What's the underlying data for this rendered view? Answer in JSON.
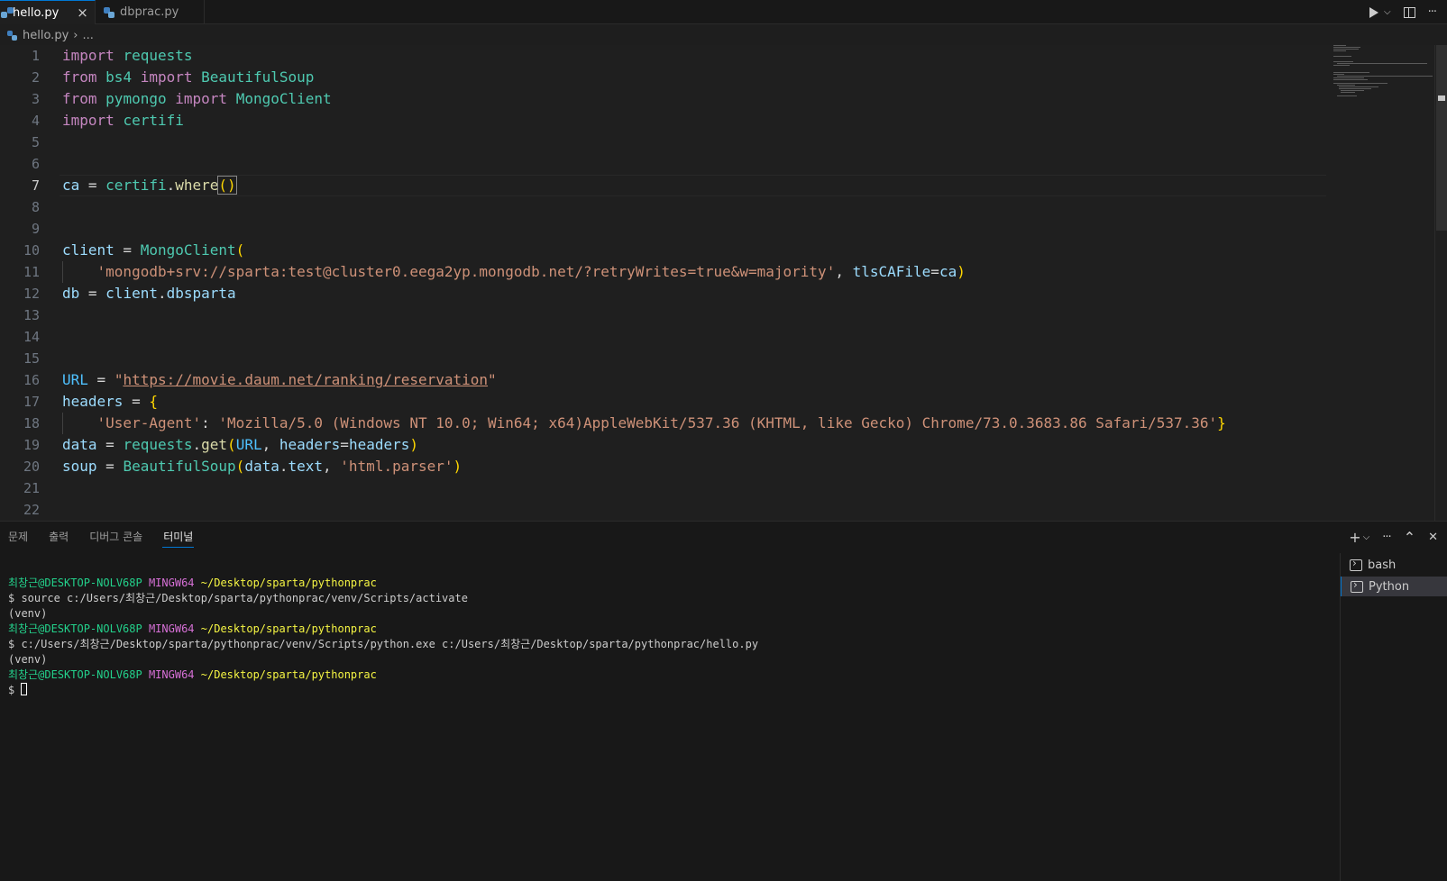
{
  "tabs": [
    {
      "label": "hello.py",
      "active": true,
      "close": "×"
    },
    {
      "label": "dbprac.py",
      "active": false
    }
  ],
  "tab_actions": {
    "run": "run-icon",
    "dropdown": "⌵",
    "split": "split-editor-icon",
    "more": "···"
  },
  "breadcrumb": {
    "file": "hello.py",
    "separator": "›",
    "rest": "..."
  },
  "editor": {
    "current_line": 7,
    "line_numbers": [
      "1",
      "2",
      "3",
      "4",
      "5",
      "6",
      "7",
      "8",
      "9",
      "10",
      "11",
      "12",
      "13",
      "14",
      "15",
      "16",
      "17",
      "18",
      "19",
      "20",
      "21",
      "22"
    ]
  },
  "code": {
    "l1": {
      "k": "import",
      "m": "requests"
    },
    "l2": {
      "k1": "from",
      "m": "bs4",
      "k2": "import",
      "c": "BeautifulSoup"
    },
    "l3": {
      "k1": "from",
      "m": "pymongo",
      "k2": "import",
      "c": "MongoClient"
    },
    "l4": {
      "k": "import",
      "m": "certifi"
    },
    "l7": {
      "v": "ca",
      "op": " = ",
      "m": "certifi",
      "dot": ".",
      "f": "where",
      "paren": "()"
    },
    "l10": {
      "v": "client",
      "op": " = ",
      "c": "MongoClient",
      "p": "("
    },
    "l11": {
      "s": "'mongodb+srv://sparta:test@cluster0.eega2yp.mongodb.net/?retryWrites=true&w=majority'",
      "comma": ", ",
      "kw": "tlsCAFile",
      "eq": "=",
      "v": "ca",
      "p": ")"
    },
    "l12": {
      "v": "db",
      "op": " = ",
      "v2": "client",
      "dot": ".",
      "v3": "dbsparta"
    },
    "l16": {
      "v": "URL",
      "op": " = ",
      "q1": "\"",
      "url": "https://movie.daum.net/ranking/reservation",
      "q2": "\""
    },
    "l17": {
      "v": "headers",
      "op": " = ",
      "p": "{"
    },
    "l18": {
      "s1": "'User-Agent'",
      "colon": ": ",
      "s2": "'Mozilla/5.0 (Windows NT 10.0; Win64; x64)AppleWebKit/537.36 (KHTML, like Gecko) Chrome/73.0.3683.86 Safari/537.36'",
      "p": "}"
    },
    "l19": {
      "v": "data",
      "op": " = ",
      "m": "requests",
      "dot": ".",
      "f": "get",
      "p1": "(",
      "a": "URL",
      "comma": ", ",
      "kw": "headers",
      "eq": "=",
      "v2": "headers",
      "p2": ")"
    },
    "l20": {
      "v": "soup",
      "op": " = ",
      "c": "BeautifulSoup",
      "p1": "(",
      "a": "data",
      "dot": ".",
      "a2": "text",
      "comma": ", ",
      "s": "'html.parser'",
      "p2": ")"
    }
  },
  "panel": {
    "tabs": [
      "문제",
      "출력",
      "디버그 콘솔",
      "터미널"
    ],
    "active_tab": "터미널",
    "actions": {
      "add": "+",
      "dropdown": "⌵",
      "more": "···",
      "maximize": "⌃",
      "close": "✕"
    }
  },
  "terminal": {
    "user": "최창근@DESKTOP-NOLV68P",
    "shell": "MINGW64",
    "path": "~/Desktop/sparta/pythonprac",
    "cmd1": "$ source c:/Users/최창근/Desktop/sparta/pythonprac/venv/Scripts/activate",
    "venv": "(venv)",
    "cmd2": "$ c:/Users/최창근/Desktop/sparta/pythonprac/venv/Scripts/python.exe c:/Users/최창근/Desktop/sparta/pythonprac/hello.py",
    "prompt": "$ "
  },
  "terminal_list": [
    {
      "label": "bash",
      "active": false
    },
    {
      "label": "Python",
      "active": true
    }
  ]
}
